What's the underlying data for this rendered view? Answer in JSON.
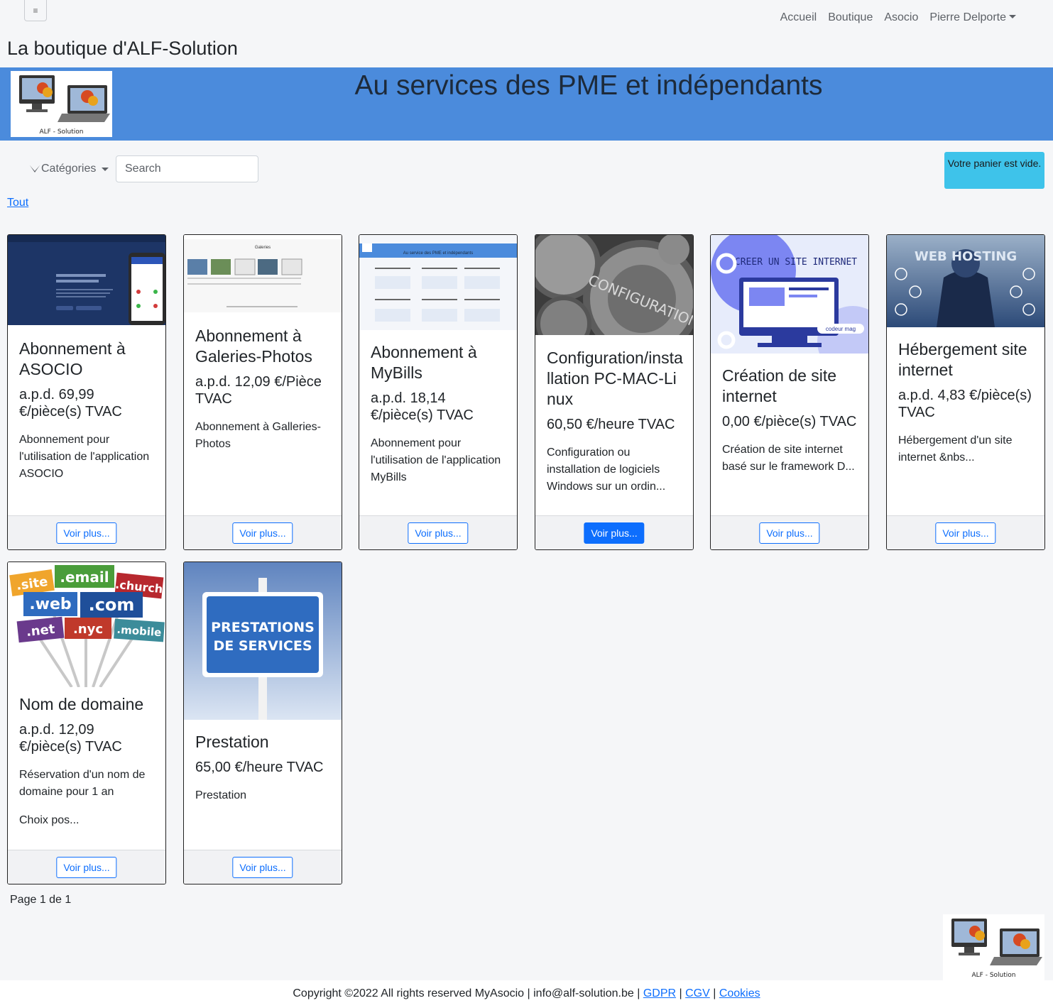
{
  "nav": {
    "toggler_icon": "≡",
    "items": [
      {
        "label": "Accueil"
      },
      {
        "label": "Boutique"
      },
      {
        "label": "Asocio"
      },
      {
        "label": "Pierre Delporte"
      }
    ]
  },
  "site_title": "La boutique d'ALF-Solution",
  "banner": {
    "title": "Au services des PME et indépendants",
    "logo_caption": "ALF - Solution",
    "color": "#4b8bdc"
  },
  "toolbar": {
    "categories_label": "Catégories",
    "search_placeholder": "Search",
    "cart_label": "Votre panier est vide.",
    "filter_all": "Tout"
  },
  "products": [
    {
      "title": "Abonnement à ASOCIO",
      "price": "a.p.d. 69,99 €/pièce(s) TVAC",
      "desc": "Abonnement pour l'utilisation de l'application ASOCIO",
      "button": "Voir plus..."
    },
    {
      "title": "Abonnement à Galeries-Photos",
      "price": "a.p.d. 12,09 €/Pièce TVAC",
      "desc": "Abonnement à Galleries-Photos",
      "button": "Voir plus...",
      "thumb_text": "Galeries"
    },
    {
      "title": "Abonnement à MyBills",
      "price": "a.p.d. 18,14 €/pièce(s) TVAC",
      "desc": "Abonnement pour l'utilisation de l'application MyBills",
      "button": "Voir plus...",
      "thumb_text": "Au service des PME et indépendants"
    },
    {
      "title": "Configuration/installation PC-MAC-Linux",
      "price": "60,50 €/heure TVAC",
      "desc": "Configuration ou installation de logiciels Windows sur un ordin...",
      "button": "Voir plus...",
      "thumb_text": "CONFIGURATION"
    },
    {
      "title": "Création de site internet",
      "price": "0,00 €/pièce(s) TVAC",
      "desc": "Création de site internet basé sur le framework D...",
      "button": "Voir plus...",
      "thumb_text": "CREER UN SITE INTERNET",
      "thumb_brand": "codeur mag"
    },
    {
      "title": "Hébergement site internet",
      "price": "a.p.d. 4,83 €/pièce(s) TVAC",
      "desc": "Hébergement d'un site internet   &nbs...",
      "button": "Voir plus...",
      "thumb_text": "WEB HOSTING"
    },
    {
      "title": "Nom de domaine",
      "price": "a.p.d. 12,09 €/pièce(s) TVAC",
      "desc": "Réservation d'un nom de domaine pour 1 an",
      "desc2": "Choix pos...",
      "button": "Voir plus...",
      "thumb_tlds": [
        ".site",
        ".email",
        ".church",
        ".web",
        ".com",
        ".net",
        ".nyc",
        ".mobile"
      ]
    },
    {
      "title": "Prestation",
      "price": "65,00 €/heure TVAC",
      "desc": "Prestation",
      "button": "Voir plus...",
      "thumb_lines": [
        "PRESTATIONS",
        "DE SERVICES"
      ]
    }
  ],
  "pagination": "Page 1 de 1",
  "footer": {
    "logo_caption": "ALF - Solution",
    "copyright": "Copyright ©2022 All rights reserved MyAsocio | info@alf-solution.be |",
    "links": [
      "GDPR",
      "CGV",
      "Cookies"
    ]
  }
}
